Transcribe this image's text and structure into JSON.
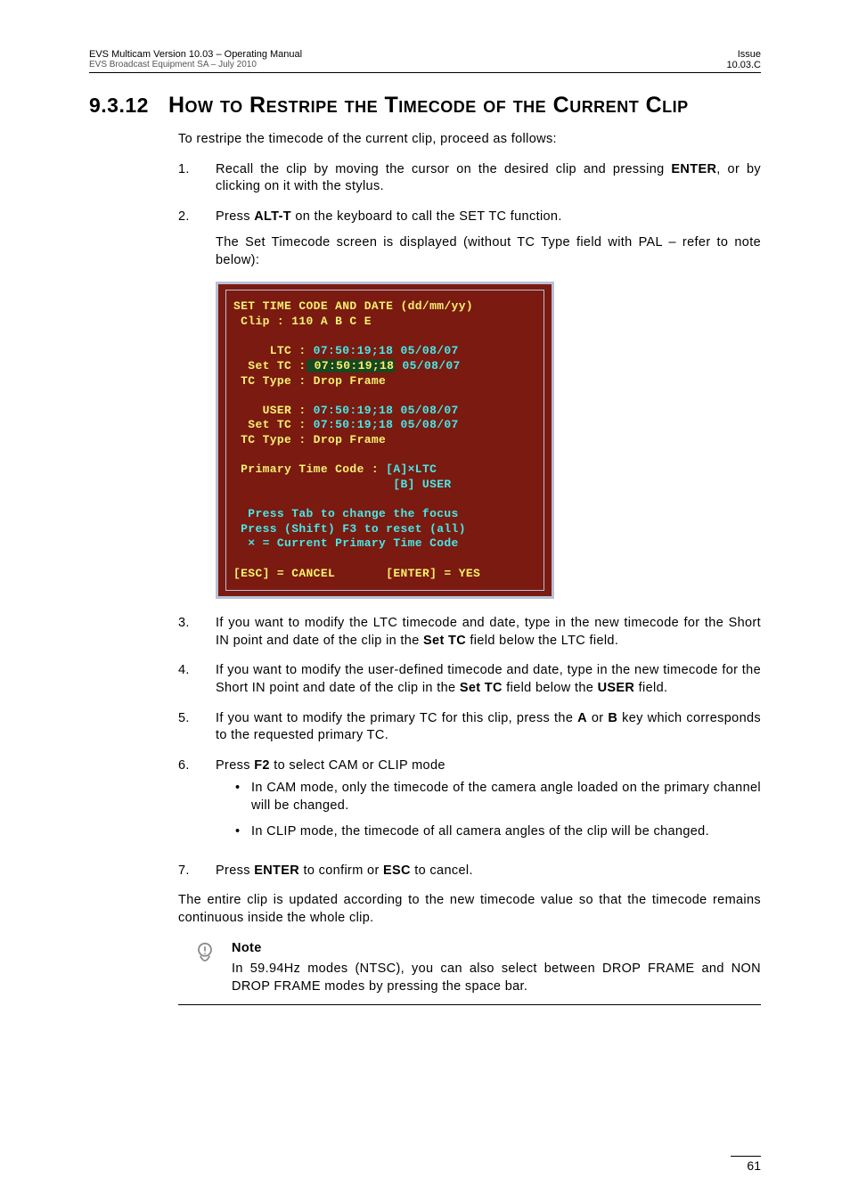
{
  "header": {
    "title_line": "EVS Multicam Version 10.03  – Operating Manual",
    "sub_line": "EVS Broadcast Equipment SA – July 2010",
    "issue_label": "Issue",
    "issue_value": "10.03.C"
  },
  "section": {
    "number": "9.3.12",
    "title": "How to Restripe the Timecode of the Current Clip"
  },
  "intro": "To restripe the timecode of the current clip, proceed as follows:",
  "steps": {
    "s1": {
      "num": "1.",
      "text_a": "Recall the clip by moving the cursor on the desired clip and pressing ",
      "bold": "ENTER",
      "text_b": ", or by clicking on it with the stylus."
    },
    "s2": {
      "num": "2.",
      "line1_a": "Press ",
      "line1_bold": "ALT-T",
      "line1_b": " on the keyboard to call the SET TC function.",
      "line2": "The Set Timecode screen is displayed (without TC Type field with PAL – refer to note below):"
    },
    "s3": {
      "num": "3.",
      "a": "If you want to modify the LTC timecode and date, type in the new timecode for the Short IN point and date of the clip in the ",
      "b1": "Set TC",
      "b": " field below the LTC field."
    },
    "s4": {
      "num": "4.",
      "a": "If you want to modify the user-defined timecode and date, type in the new timecode for the Short IN point and date of the clip in the ",
      "b1": "Set TC",
      "b": " field below the ",
      "b2": "USER",
      "c": " field."
    },
    "s5": {
      "num": "5.",
      "a": "If you want to modify the primary TC for this clip, press the ",
      "b1": "A",
      "b": " or ",
      "b2": "B",
      "c": " key which corresponds to the requested primary TC."
    },
    "s6": {
      "num": "6.",
      "a": "Press ",
      "b1": "F2",
      "b": " to select CAM or CLIP mode",
      "bullets": [
        "In CAM mode, only the timecode of the camera angle loaded on the primary channel will be changed.",
        "In CLIP mode, the timecode of all camera angles of the clip will be changed."
      ]
    },
    "s7": {
      "num": "7.",
      "a": "Press ",
      "b1": "ENTER",
      "b": " to confirm or ",
      "b2": "ESC",
      "c": " to cancel."
    }
  },
  "closing": "The entire clip is updated according to the new timecode value so that the timecode remains continuous inside the whole clip.",
  "note": {
    "heading": "Note",
    "body": "In 59.94Hz modes (NTSC), you can also select between DROP FRAME and NON DROP FRAME modes by pressing the space bar."
  },
  "screen": {
    "title": "SET TIME CODE AND DATE (dd/mm/yy)",
    "clip": "Clip : 110 A B C E",
    "ltc_lbl": "     LTC :",
    "ltc_val": " 07:50:19;18 05/08/07",
    "settc1_lbl": "  Set TC :",
    "settc1_hl": " 07:50:19;18",
    "settc1_val": " 05/08/07",
    "tctype1": " TC Type : Drop Frame",
    "user_lbl": "    USER :",
    "user_val": " 07:50:19;18 05/08/07",
    "settc2_lbl": "  Set TC :",
    "settc2_val": " 07:50:19;18 05/08/07",
    "tctype2": " TC Type : Drop Frame",
    "prim_lbl": " Primary Time Code :",
    "prim_a": " [A]×LTC",
    "prim_b": "                      [B] USER",
    "help1": "  Press Tab to change the focus",
    "help2": " Press (Shift) F3 to reset (all)",
    "help3": "  × = Current Primary Time Code",
    "esc": "[ESC] = CANCEL",
    "enter": "[ENTER] = YES"
  },
  "page_number": "61"
}
